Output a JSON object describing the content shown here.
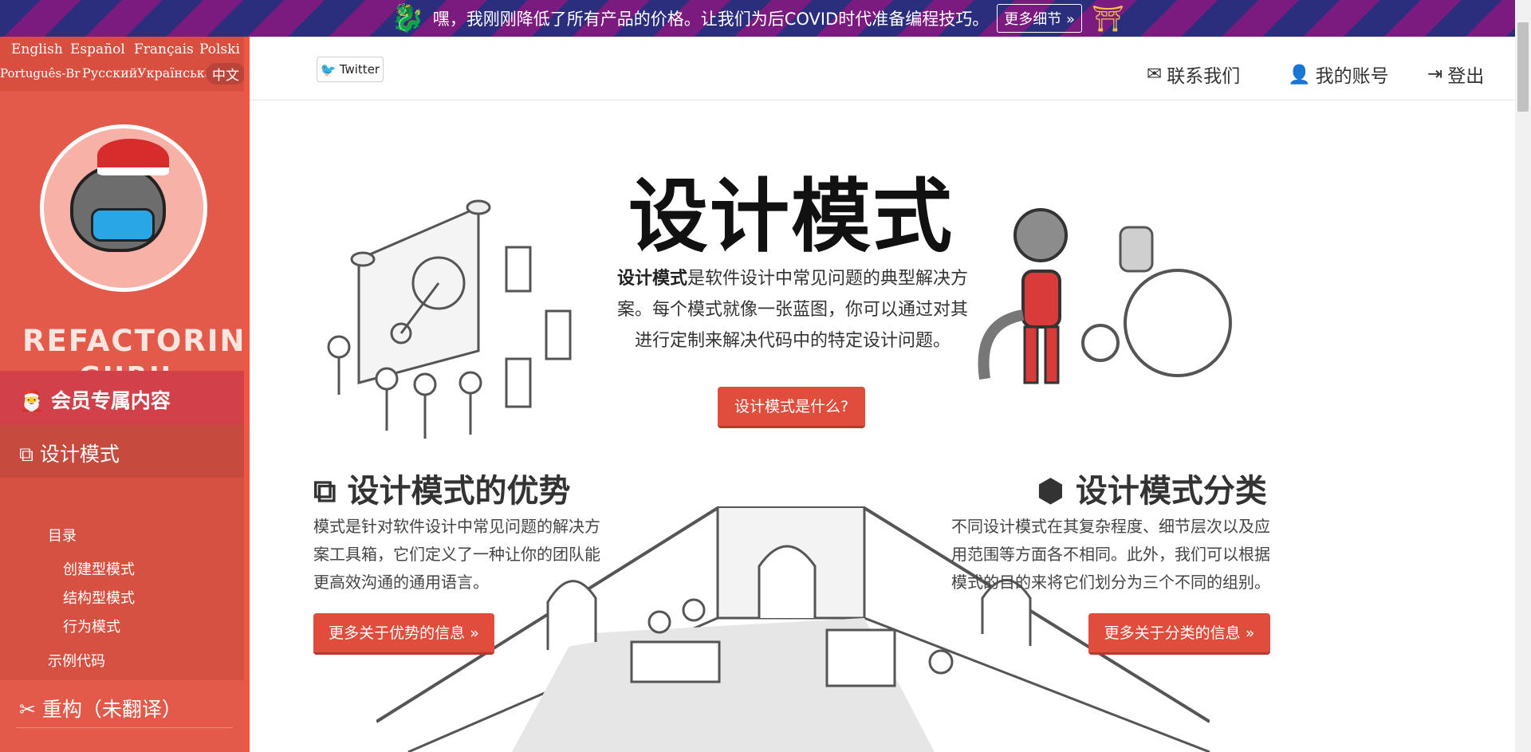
{
  "banner": {
    "text": "嘿，我刚刚降低了所有产品的价格。让我们为后COVID时代准备编程技巧。",
    "more_label": "更多细节 »"
  },
  "sidebar": {
    "languages": [
      "English",
      "Español",
      "Français",
      "Polski",
      "Português-Br",
      "Русский",
      "Українська",
      "中文"
    ],
    "logo_line1": "REFACTORING",
    "logo_line2": "·GURU·",
    "member_label": "会员专属内容",
    "patterns_label": "设计模式",
    "sub_items": [
      "目录",
      "创建型模式",
      "结构型模式",
      "行为模式",
      "示例代码"
    ],
    "refactor_label": "重构（未翻译）"
  },
  "header": {
    "twitter_label": "Twitter",
    "contact_label": "联系我们",
    "account_label": "我的账号",
    "logout_label": "登出"
  },
  "main": {
    "title": "设计模式",
    "desc_bold": "设计模式",
    "desc_rest": "是软件设计中常见问题的典型解决方案。每个模式就像一张蓝图，你可以通过对其进行定制来解决代码中的特定设计问题。",
    "what_button": "设计模式是什么?",
    "benefits_title": "设计模式的优势",
    "benefits_text": "模式是针对软件设计中常见问题的解决方案工具箱，它们定义了一种让你的团队能更高效沟通的通用语言。",
    "benefits_button": "更多关于优势的信息 »",
    "classify_title": "设计模式分类",
    "classify_text": "不同设计模式在其复杂程度、细节层次以及应用范围等方面各不相同。此外，我们可以根据模式的目的来将它们划分为三个不同的组别。",
    "classify_button": "更多关于分类的信息 »"
  },
  "colors": {
    "sidebar": "#e35a4a",
    "accent_button": "#e14d3c",
    "banner_blue": "#2b2e7c",
    "banner_purple": "#7b1a7f"
  }
}
